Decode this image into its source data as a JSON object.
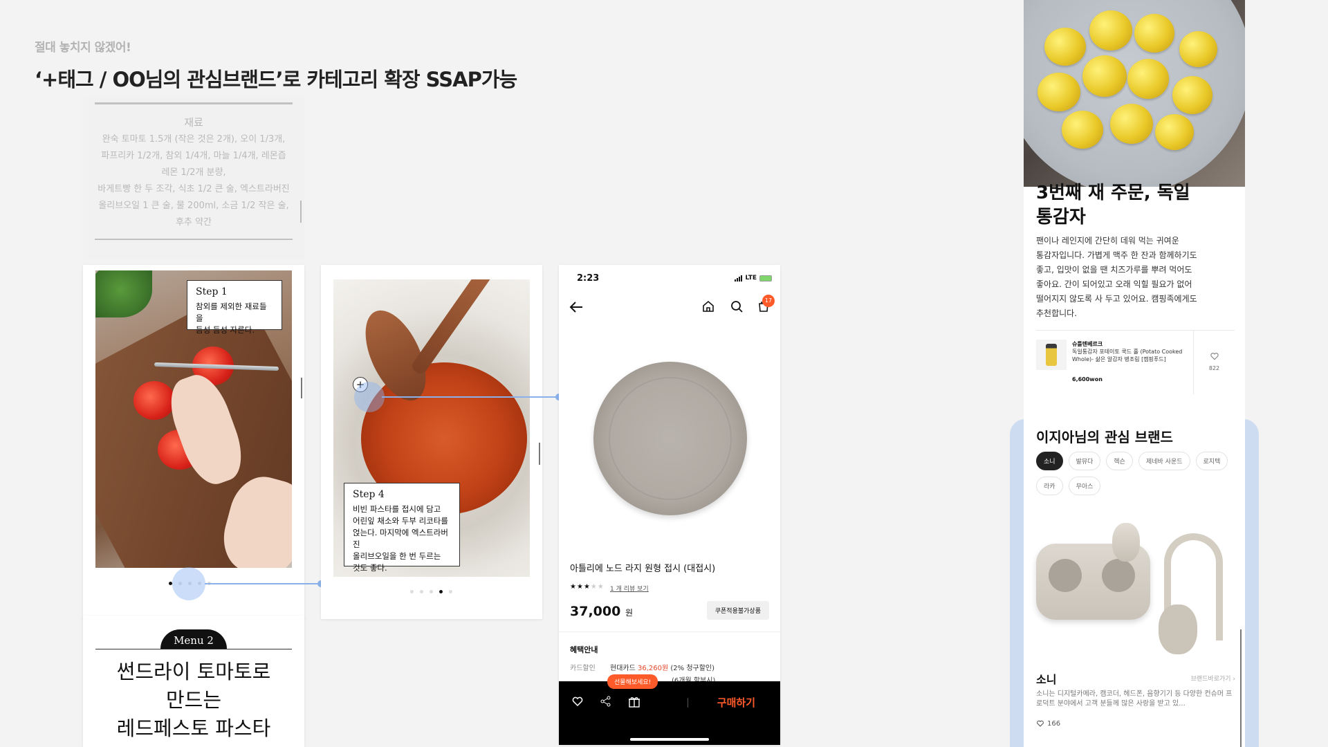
{
  "header": {
    "subtitle": "절대 놓치지 않겠어!",
    "headline": "‘+태그 / OO님의 관심브랜드’로 카테고리 확장 SSAP가능"
  },
  "ingredients": {
    "title": "재료",
    "body": "완숙 토마토 1.5개 (작은 것은 2개), 오이 1/3개,\n파프리카 1/2개, 참외 1/4개, 마늘 1/4개, 레몬즙\n레몬 1/2개 분량,\n바게트빵 한 두 조각, 식초 1/2 큰 술, 엑스트라버진\n올리브오일 1 큰 술, 물 200ml, 소금 1/2 작은 술,\n후추 약간"
  },
  "step1": {
    "title": "Step 1",
    "desc": "참외를 제외한 재료들을\n듬성 듬성 자른다."
  },
  "step4": {
    "title": "Step 4",
    "desc": "비빈 파스타를 접시에 담고\n어린잎 채소와 두부 리코타를\n얹는다. 마지막에 엑스트라버진\n올리브오일을 한 번 두르는\n것도 좋다.",
    "plus": "+"
  },
  "menu2": {
    "badge": "Menu 2",
    "title": "썬드라이 토마토로\n만드는\n레드페스토 파스타"
  },
  "phone": {
    "time": "2:23",
    "network": "LTE",
    "cart_count": "17",
    "product_name": "아틀리에 노드 라지 원형 접시 (대접시)",
    "review_link": "1 개 리뷰 보기",
    "rating": 3,
    "rating_max": 5,
    "price": "37,000",
    "price_unit": "원",
    "coupon": "쿠폰적용불가상품",
    "benefit_title": "혜택안내",
    "card_label": "카드할인",
    "card_vendor": "현대카드",
    "card_price": "36,260원",
    "card_note": "(2% 청구할인)",
    "installment": "(6개월 할부시)",
    "gift_tip": "선물해보세요!",
    "buy": "구매하기"
  },
  "recipe": {
    "title": "3번째 재 주문, 독일\n통감자",
    "desc": "팬이나 레인지에 간단히 데워 먹는 귀여운\n통감자입니다. 가볍게 맥주 한 잔과 함께하기도\n좋고, 입맛이 없을 땐 치즈가루를 뿌려 먹어도\n좋아요. 간이 되어있고 오래 익힐 필요가 없어\n떨어지지 않도록 사 두고 있어요. 캠핑족에게도\n추천합니다.",
    "product": {
      "brand": "슈틀텐베르크",
      "name": "독일통감자 포테이토 쿡드 홀 (Potato Cooked Whole)- 삶은 알감자 병조림 [캠핑푸드]",
      "price": "6,600won",
      "likes": "822"
    }
  },
  "brands": {
    "title": "이지아님의 관심 브랜드",
    "chips": [
      "소니",
      "발뮤다",
      "헥슨",
      "제네바 사운드",
      "로지텍",
      "라카",
      "무아스"
    ],
    "active_chip": "소니",
    "brand_name": "소니",
    "brand_link": "브랜드바로가기 ›",
    "brand_desc": "소니는 디지털카메라, 캠코더, 헤드폰, 음향기기 등 다양한 컨슈머 프로덕트 분야에서 고객 분들께 많은 사랑을 받고 있...",
    "likes": "166"
  },
  "colors": {
    "accent": "#ff5a2a",
    "highlight": "#8ab0ea",
    "panel": "#cddcf1"
  }
}
